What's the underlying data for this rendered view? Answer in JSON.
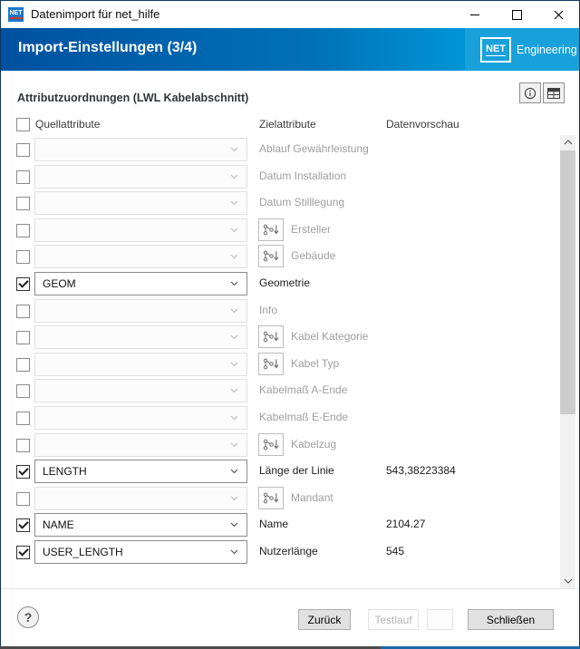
{
  "window": {
    "title": "Datenimport für net_hilfe",
    "app_icon_text": "NET",
    "controls": {
      "minimize": "minimize",
      "maximize": "maximize",
      "close": "✕"
    }
  },
  "header": {
    "title": "Import-Einstellungen (3/4)",
    "logo_box_text": "NET",
    "logo_word": "Engineering",
    "colors": {
      "gradient_start": "#00519f",
      "gradient_end": "#0095d6",
      "right_panel": "#18a1da"
    }
  },
  "mapping": {
    "section_title": "Attributzuordnungen (LWL Kabelabschnitt)",
    "columns": {
      "source": "Quellattribute",
      "target": "Zielattribute",
      "preview": "Datenvorschau"
    },
    "rows": [
      {
        "checked": false,
        "enabled": false,
        "source": "",
        "has_mapping_icon": false,
        "target": "Ablauf Gewährleistung",
        "preview": ""
      },
      {
        "checked": false,
        "enabled": false,
        "source": "",
        "has_mapping_icon": false,
        "target": "Datum Installation",
        "preview": ""
      },
      {
        "checked": false,
        "enabled": false,
        "source": "",
        "has_mapping_icon": false,
        "target": "Datum Stilllegung",
        "preview": ""
      },
      {
        "checked": false,
        "enabled": false,
        "source": "",
        "has_mapping_icon": true,
        "target": "Ersteller",
        "preview": ""
      },
      {
        "checked": false,
        "enabled": false,
        "source": "",
        "has_mapping_icon": true,
        "target": "Gebäude",
        "preview": ""
      },
      {
        "checked": true,
        "enabled": true,
        "source": "GEOM",
        "has_mapping_icon": false,
        "target": "Geometrie",
        "preview": ""
      },
      {
        "checked": false,
        "enabled": false,
        "source": "",
        "has_mapping_icon": false,
        "target": "Info",
        "preview": ""
      },
      {
        "checked": false,
        "enabled": false,
        "source": "",
        "has_mapping_icon": true,
        "target": "Kabel Kategorie",
        "preview": ""
      },
      {
        "checked": false,
        "enabled": false,
        "source": "",
        "has_mapping_icon": true,
        "target": "Kabel Typ",
        "preview": ""
      },
      {
        "checked": false,
        "enabled": false,
        "source": "",
        "has_mapping_icon": false,
        "target": "Kabelmaß A-Ende",
        "preview": ""
      },
      {
        "checked": false,
        "enabled": false,
        "source": "",
        "has_mapping_icon": false,
        "target": "Kabelmaß E-Ende",
        "preview": ""
      },
      {
        "checked": false,
        "enabled": false,
        "source": "",
        "has_mapping_icon": true,
        "target": "Kabelzug",
        "preview": ""
      },
      {
        "checked": true,
        "enabled": true,
        "source": "LENGTH",
        "has_mapping_icon": false,
        "target": "Länge der Linie",
        "preview": "543,38223384"
      },
      {
        "checked": false,
        "enabled": false,
        "source": "",
        "has_mapping_icon": true,
        "target": "Mandant",
        "preview": ""
      },
      {
        "checked": true,
        "enabled": true,
        "source": "NAME",
        "has_mapping_icon": false,
        "target": "Name",
        "preview": "2104.27"
      },
      {
        "checked": true,
        "enabled": true,
        "source": "USER_LENGTH",
        "has_mapping_icon": false,
        "target": "Nutzerlänge",
        "preview": "545"
      }
    ]
  },
  "footer": {
    "help_label": "?",
    "back_label": "Zurück",
    "test_label": "Testlauf",
    "empty_label": "",
    "close_label": "Schließen"
  }
}
